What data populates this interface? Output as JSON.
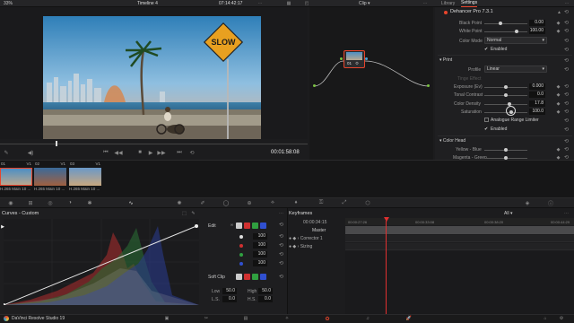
{
  "viewer": {
    "zoom": "33%",
    "timeline": "Timeline 4",
    "timecode": "07:14:42:17",
    "playhead_tc": "00:01:58:08"
  },
  "sign_text": "SLOW",
  "node_panel": {
    "mode": "Clip",
    "node_label": "01"
  },
  "tabs": {
    "library": "Library",
    "settings": "Settings"
  },
  "plugin": {
    "title": "Dehancer Pro 7.3.1",
    "black_point": {
      "label": "Black Point",
      "value": "0.00"
    },
    "white_point": {
      "label": "White Point",
      "value": "100.00"
    },
    "color_mode": {
      "label": "Color Mode",
      "value": "Normal"
    },
    "enabled1": "Enabled",
    "print_section": "Print",
    "profile": {
      "label": "Profile",
      "value": "Linear"
    },
    "tinge": {
      "label": "Tinge Effect"
    },
    "exposure": {
      "label": "Exposure (Ev)",
      "value": "0.000"
    },
    "tonal": {
      "label": "Tonal Contrast",
      "value": "0.0"
    },
    "density": {
      "label": "Color Density",
      "value": "17.8"
    },
    "saturation": {
      "label": "Saturation",
      "value": "100.0"
    },
    "limiter": "Analogue Range Limiter",
    "enabled2": "Enabled",
    "colorhead_section": "Color Head",
    "yellow_blue": "Yellow - Blue",
    "magenta_green": "Magenta - Green"
  },
  "clips": [
    {
      "num": "01",
      "track": "V1",
      "name": "H.265 Main 10 ..."
    },
    {
      "num": "02",
      "track": "V1",
      "name": "H.265 Main 10 ..."
    },
    {
      "num": "03",
      "track": "V1",
      "name": "H.265 Main 10 ..."
    }
  ],
  "curves": {
    "title": "Curves - Custom",
    "edit": "Edit",
    "values": [
      "100",
      "100",
      "100",
      "100"
    ],
    "softclip": "Soft Clip",
    "low_label": "Low",
    "low_val": "50.0",
    "high_label": "High",
    "high_val": "50.0",
    "ls_label": "L.S.",
    "ls_val": "0.0",
    "hs_label": "H.S.",
    "hs_val": "0.0"
  },
  "keyframes": {
    "title": "Keyframes",
    "filter": "All",
    "timecode": "00:00:34:15",
    "ruler": [
      "00:00:27:26",
      "00:00:33:08",
      "00:00:38:20",
      "00:00:44:29"
    ],
    "master": "Master",
    "corrector": "Corrector 1",
    "sizing": "Sizing"
  },
  "footer": {
    "app": "DaVinci Resolve Studio 19"
  },
  "colors": {
    "accent": "#e8452c",
    "playhead": "#e03030",
    "bg": "#1c1c1e"
  }
}
